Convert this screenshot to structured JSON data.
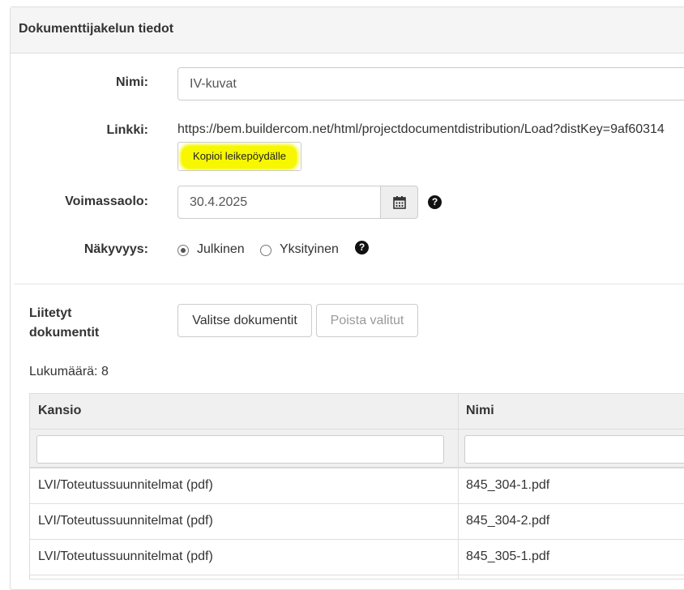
{
  "panel": {
    "title": "Dokumenttijakelun tiedot"
  },
  "form": {
    "name_label": "Nimi:",
    "name_value": "IV-kuvat",
    "link_label": "Linkki:",
    "link_value": "https://bem.buildercom.net/html/projectdocumentdistribution/Load?distKey=9af60314",
    "copy_button": "Kopioi leikepöydälle",
    "validity_label": "Voimassaolo:",
    "validity_value": "30.4.2025",
    "visibility_label": "Näkyvyys:",
    "visibility_options": [
      "Julkinen",
      "Yksityinen"
    ],
    "visibility_selected": "Julkinen",
    "help_glyph": "?"
  },
  "documents": {
    "section_label": "Liitetyt dokumentit",
    "select_button": "Valitse dokumentit",
    "remove_button": "Poista valitut",
    "count_text": "Lukumäärä: 8"
  },
  "table": {
    "columns": [
      "Kansio",
      "Nimi"
    ],
    "rows": [
      [
        "LVI/Toteutussuunnitelmat (pdf)",
        "845_304-1.pdf"
      ],
      [
        "LVI/Toteutussuunnitelmat (pdf)",
        "845_304-2.pdf"
      ],
      [
        "LVI/Toteutussuunnitelmat (pdf)",
        "845_305-1.pdf"
      ]
    ]
  },
  "colors": {
    "highlight": "#f7f700",
    "heading_bg": "#f5f5f5",
    "border": "#dddddd"
  },
  "icons": {
    "calendar": "calendar-icon",
    "help": "question-circle-icon",
    "radio": "radio-button-icon"
  }
}
